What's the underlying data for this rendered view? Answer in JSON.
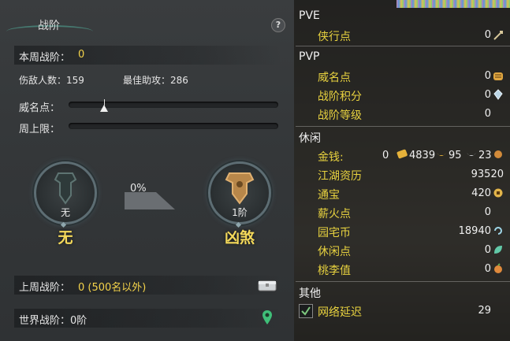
{
  "left_panel": {
    "title": "战阶",
    "help": "?",
    "weekly_rank_label": "本周战阶：",
    "weekly_rank_value": "0",
    "kills_label": "伤敌人数：159",
    "best_assist_label": "最佳助攻：286",
    "prestige_label": "威名点：",
    "prestige_progress": 0.17,
    "weekly_cap_label": "周上限：",
    "weekly_cap_progress": 0,
    "progress_percent": "0%",
    "current_rank": {
      "level": "无",
      "name": "无"
    },
    "next_rank": {
      "level": "1阶",
      "name": "凶煞"
    },
    "last_week_label": "上周战阶：",
    "last_week_value": "0 (500名以外)",
    "world_label": "世界战阶：0阶"
  },
  "right_panel": {
    "pve_header": "PVE",
    "pve_items": [
      {
        "label": "侠行点",
        "value": "0",
        "icon": "sword-icon"
      }
    ],
    "pvp_header": "PVP",
    "pvp_items": [
      {
        "label": "威名点",
        "value": "0",
        "icon": "tiger-icon"
      },
      {
        "label": "战阶积分",
        "value": "0",
        "icon": "crystal-icon"
      },
      {
        "label": "战阶等级",
        "value": "0",
        "icon": ""
      }
    ],
    "leisure_header": "休闲",
    "money": {
      "label": "金钱:",
      "v1": "0",
      "v2": "4839",
      "v3": "95",
      "v4": "23"
    },
    "leisure_items": [
      {
        "label": "江湖资历",
        "value": "93520",
        "icon": ""
      },
      {
        "label": "通宝",
        "value": "420",
        "icon": "coin-icon"
      },
      {
        "label": "薪火点",
        "value": "0",
        "icon": ""
      },
      {
        "label": "园宅币",
        "value": "18940",
        "icon": "swirl-icon"
      },
      {
        "label": "休闲点",
        "value": "0",
        "icon": "leaf-icon"
      },
      {
        "label": "桃李值",
        "value": "0",
        "icon": "peach-icon"
      }
    ],
    "other_header": "其他",
    "latency": {
      "label": "网络延迟",
      "value": "29",
      "checked": true
    }
  },
  "colors": {
    "accent": "#f4d34a",
    "label_yellow": "#e8d23f",
    "panel": "#36393b"
  }
}
